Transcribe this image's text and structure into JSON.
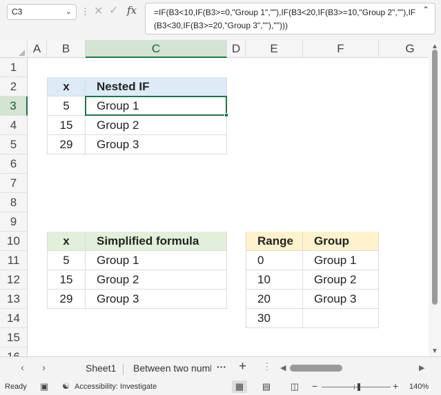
{
  "formula_bar": {
    "namebox": "C3",
    "formula": "=IF(B3<10,IF(B3>=0,\"Group 1\",\"\"),IF(B3<20,IF(B3>=10,\"Group 2\",\"\"),IF(B3<30,IF(B3>=20,\"Group 3\",\"\"),\"\")))"
  },
  "columns": [
    "A",
    "B",
    "C",
    "D",
    "E",
    "F",
    "G"
  ],
  "rows": [
    "1",
    "2",
    "3",
    "4",
    "5",
    "6",
    "7",
    "8",
    "9",
    "10",
    "11",
    "12",
    "13",
    "14",
    "15",
    "16"
  ],
  "table1": {
    "header": [
      "x",
      "Nested IF"
    ],
    "rows": [
      [
        "5",
        "Group 1"
      ],
      [
        "15",
        "Group 2"
      ],
      [
        "29",
        "Group 3"
      ]
    ]
  },
  "table2": {
    "header": [
      "x",
      "Simplified formula"
    ],
    "rows": [
      [
        "5",
        "Group 1"
      ],
      [
        "15",
        "Group 2"
      ],
      [
        "29",
        "Group 3"
      ]
    ]
  },
  "table3": {
    "header": [
      "Range",
      "Group"
    ],
    "rows": [
      [
        "0",
        "Group 1"
      ],
      [
        "10",
        "Group 2"
      ],
      [
        "20",
        "Group 3"
      ],
      [
        "30",
        ""
      ]
    ]
  },
  "tabs": {
    "sheets": [
      "Sheet1",
      "Between two numl"
    ]
  },
  "status": {
    "ready": "Ready",
    "accessibility": "Accessibility: Investigate",
    "zoom": "140%"
  },
  "colors": {
    "table1_header": "#ddebf7",
    "table2_header": "#e2efda",
    "table3_header": "#fff2cc",
    "selection": "#217346"
  }
}
